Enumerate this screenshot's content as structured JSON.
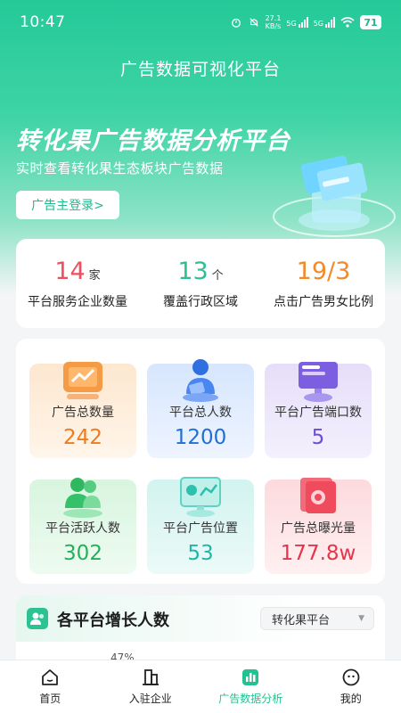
{
  "status": {
    "time": "10:47",
    "speed": "27.1",
    "speed_unit": "KB/s",
    "net1": "5G",
    "net2": "5G",
    "battery": "71"
  },
  "header": {
    "title": "广告数据可视化平台"
  },
  "hero": {
    "title": "转化果广告数据分析平台",
    "subtitle": "实时查看转化果生态板块广告数据",
    "login_button": "广告主登录>"
  },
  "summary": [
    {
      "value": "14",
      "unit": "家",
      "label": "平台服务企业数量",
      "color": "#f14e5d"
    },
    {
      "value": "13",
      "unit": "个",
      "label": "覆盖行政区域",
      "color": "#2bbf94"
    },
    {
      "value": "19/3",
      "unit": "",
      "label": "点击广告男女比例",
      "color": "#f08a2a"
    }
  ],
  "tiles": [
    {
      "label": "广告总数量",
      "value": "242",
      "color": "#f07b1e",
      "icon": "ad-chart-icon"
    },
    {
      "label": "平台总人数",
      "value": "1200",
      "color": "#1e6fd9",
      "icon": "users-icon"
    },
    {
      "label": "平台广告端口数",
      "value": "5",
      "color": "#6a4ed6",
      "icon": "monitor-icon"
    },
    {
      "label": "平台活跃人数",
      "value": "302",
      "color": "#25b05c",
      "icon": "active-users-icon"
    },
    {
      "label": "平台广告位置",
      "value": "53",
      "color": "#1fb7a6",
      "icon": "display-icon"
    },
    {
      "label": "广告总曝光量",
      "value": "177.8w",
      "color": "#e8344a",
      "icon": "exposure-icon"
    }
  ],
  "growth": {
    "title": "各平台增长人数",
    "select_value": "转化果平台",
    "peek_text": "47%"
  },
  "tabbar": [
    {
      "label": "首页",
      "icon": "home-icon",
      "active": false
    },
    {
      "label": "入驻企业",
      "icon": "building-icon",
      "active": false
    },
    {
      "label": "广告数据分析",
      "icon": "chart-icon",
      "active": true
    },
    {
      "label": "我的",
      "icon": "profile-icon",
      "active": false
    }
  ]
}
